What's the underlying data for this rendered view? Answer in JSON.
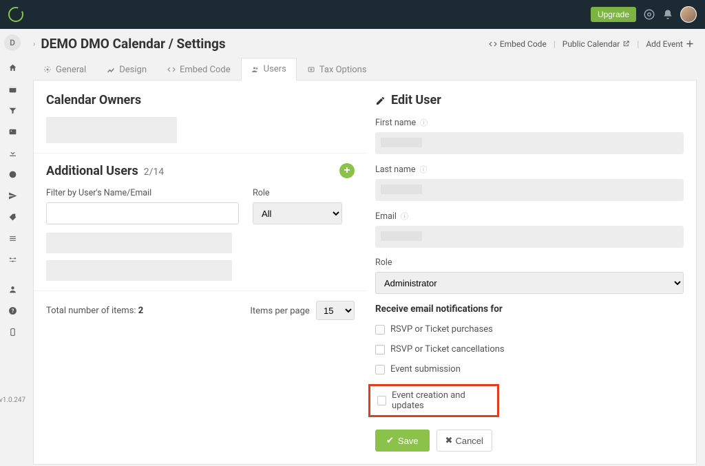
{
  "topbar": {
    "upgrade": "Upgrade"
  },
  "leftbar": {
    "badge": "D",
    "version": "v1.0.247"
  },
  "page": {
    "title": "DEMO DMO Calendar / Settings"
  },
  "headerActions": {
    "embed": "Embed Code",
    "public": "Public Calendar",
    "addEvent": "Add Event"
  },
  "tabs": [
    {
      "label": "General"
    },
    {
      "label": "Design"
    },
    {
      "label": "Embed Code"
    },
    {
      "label": "Users"
    },
    {
      "label": "Tax Options"
    }
  ],
  "left": {
    "ownersTitle": "Calendar Owners",
    "addlTitle": "Additional Users",
    "addlCount": "2/14",
    "filterNameLabel": "Filter by User's Name/Email",
    "roleLabel": "Role",
    "roleAll": "All",
    "totalLabel": "Total number of items: ",
    "totalValue": "2",
    "ippLabel": "Items per page",
    "ippValue": "15"
  },
  "right": {
    "title": "Edit User",
    "firstNameLabel": "First name",
    "lastNameLabel": "Last name",
    "emailLabel": "Email",
    "roleLabel": "Role",
    "roleValue": "Administrator",
    "notifHeader": "Receive email notifications for",
    "notif1": "RSVP or Ticket purchases",
    "notif2": "RSVP or Ticket cancellations",
    "notif3": "Event submission",
    "notif4": "Event creation and updates",
    "save": "Save",
    "cancel": "Cancel"
  }
}
